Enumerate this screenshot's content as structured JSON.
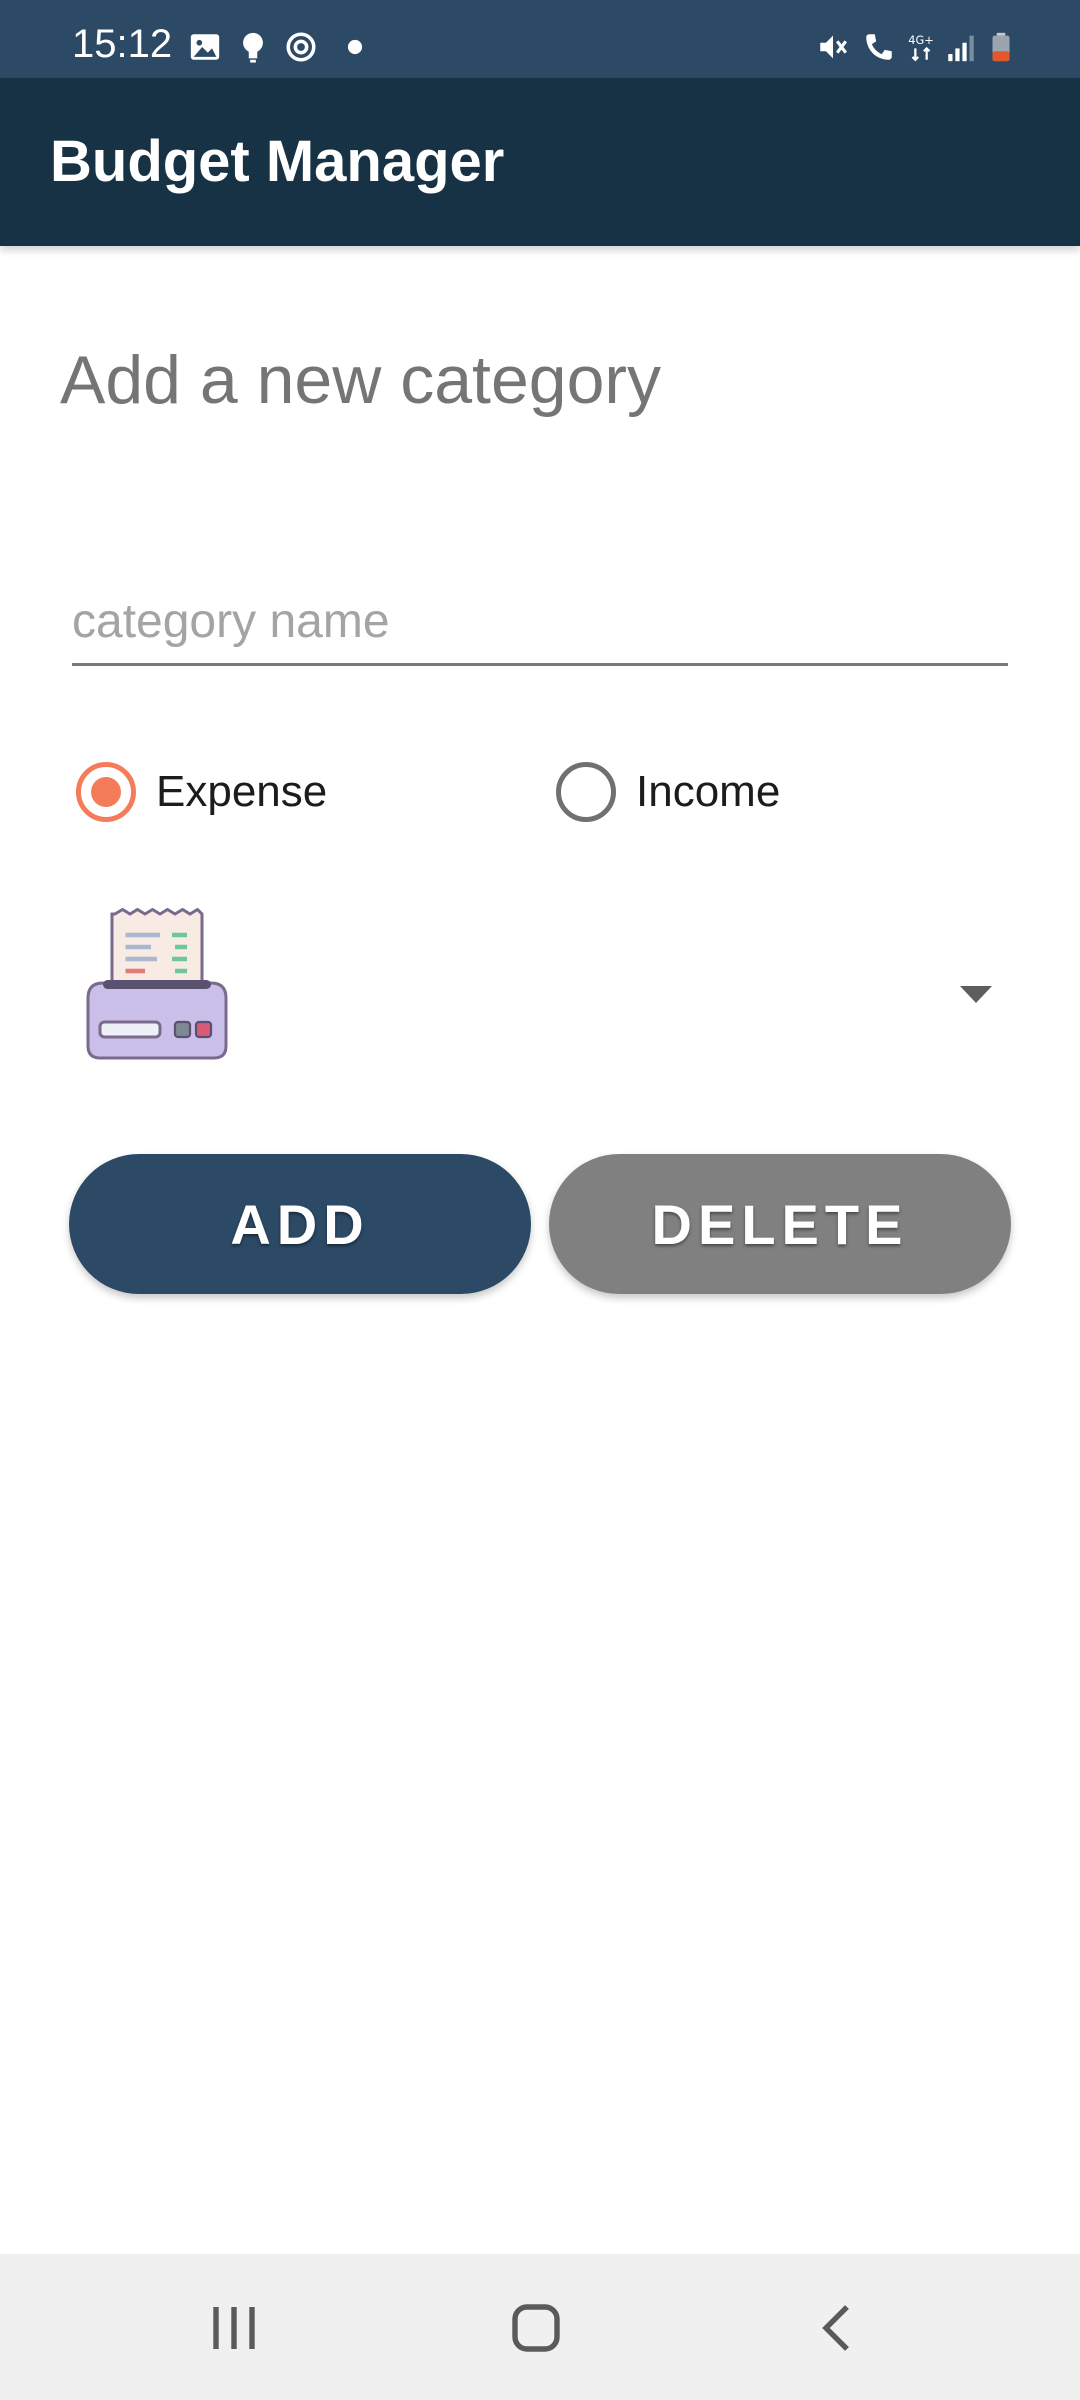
{
  "status_bar": {
    "time": "15:12",
    "left_icons": [
      "image-icon",
      "lightbulb-icon",
      "sync-icon",
      "dot-icon"
    ],
    "right_icons": [
      "mute-icon",
      "call-icon",
      "network-4g-icon",
      "signal-icon",
      "battery-icon"
    ],
    "network_label": "4G+"
  },
  "app_bar": {
    "title": "Budget Manager"
  },
  "form": {
    "heading": "Add a new category",
    "name_placeholder": "category name",
    "name_value": "",
    "type_options": [
      {
        "label": "Expense",
        "checked": true
      },
      {
        "label": "Income",
        "checked": false
      }
    ],
    "selected_icon": "receipt-printer-icon"
  },
  "buttons": {
    "add_label": "ADD",
    "delete_label": "DELETE"
  },
  "nav_bar": {
    "items": [
      "recents-icon",
      "home-icon",
      "back-icon"
    ]
  },
  "colors": {
    "status_bar": "#2c4a66",
    "app_bar": "#173244",
    "accent": "#f47c5a",
    "add_button": "#2c4a66",
    "delete_button": "#808080",
    "heading_text": "#757575"
  }
}
